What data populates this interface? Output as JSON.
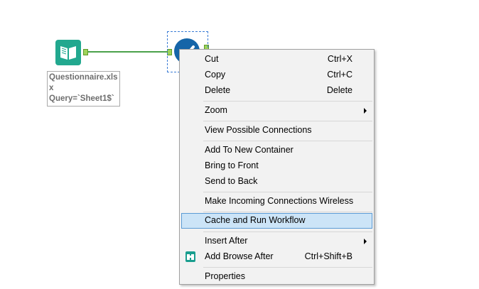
{
  "canvas": {
    "input_tool": {
      "icon": "book-input-icon",
      "annotation_lines": [
        "Questionnaire.xls",
        "x",
        "Query=`Sheet1$`"
      ]
    },
    "browse_tool": {
      "icon": "browse-check-icon"
    },
    "connection": {
      "color": "#4aa14a"
    }
  },
  "context_menu": {
    "items": [
      {
        "label": "Cut",
        "shortcut": "Ctrl+X"
      },
      {
        "label": "Copy",
        "shortcut": "Ctrl+C"
      },
      {
        "label": "Delete",
        "shortcut": "Delete"
      },
      {
        "label": "Zoom",
        "submenu": true
      },
      {
        "label": "View Possible Connections"
      },
      {
        "label": "Add To New Container"
      },
      {
        "label": "Bring to Front"
      },
      {
        "label": "Send to Back"
      },
      {
        "label": "Make Incoming Connections Wireless"
      },
      {
        "label": "Cache and Run Workflow",
        "highlighted": true
      },
      {
        "label": "Insert After",
        "submenu": true
      },
      {
        "label": "Add Browse After",
        "shortcut": "Ctrl+Shift+B",
        "icon": "binoculars-icon"
      },
      {
        "label": "Properties"
      }
    ],
    "highlight_color": "#cce4f7"
  }
}
